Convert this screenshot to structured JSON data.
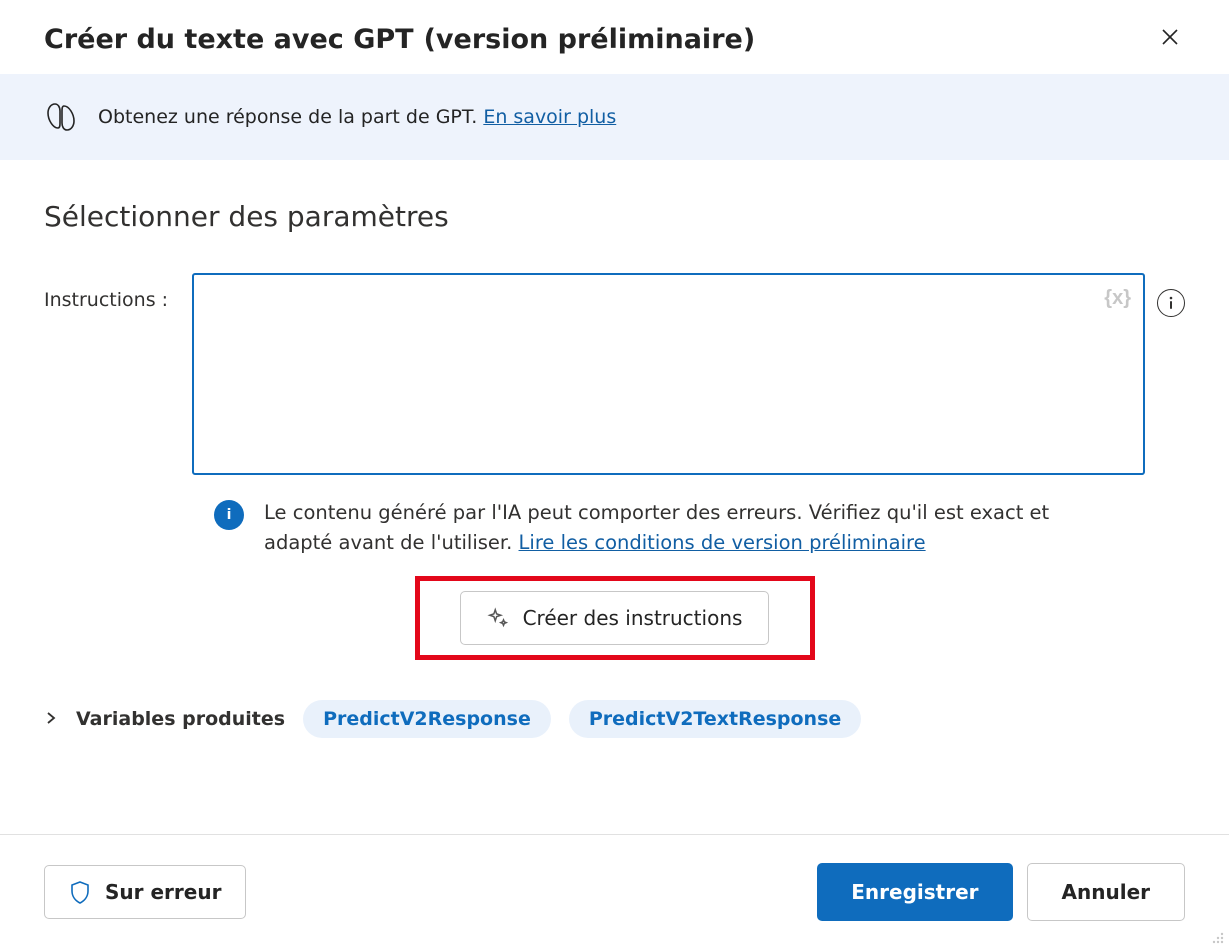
{
  "header": {
    "title": "Créer du texte avec GPT",
    "suffix": "(version préliminaire)"
  },
  "banner": {
    "text": "Obtenez une réponse de la part de GPT. ",
    "link_label": "En savoir plus"
  },
  "section": {
    "title": "Sélectionner des paramètres"
  },
  "form": {
    "instructions_label": "Instructions :",
    "instructions_value": "",
    "var_token": "{x}"
  },
  "notice": {
    "text": "Le contenu généré par l'IA peut comporter des erreurs. Vérifiez qu'il est exact et adapté avant de l'utiliser. ",
    "link_label": "Lire les conditions de version préliminaire"
  },
  "generate_button": "Créer des instructions",
  "vars": {
    "label": "Variables produites",
    "items": [
      "PredictV2Response",
      "PredictV2TextResponse"
    ]
  },
  "footer": {
    "on_error": "Sur erreur",
    "save": "Enregistrer",
    "cancel": "Annuler"
  }
}
